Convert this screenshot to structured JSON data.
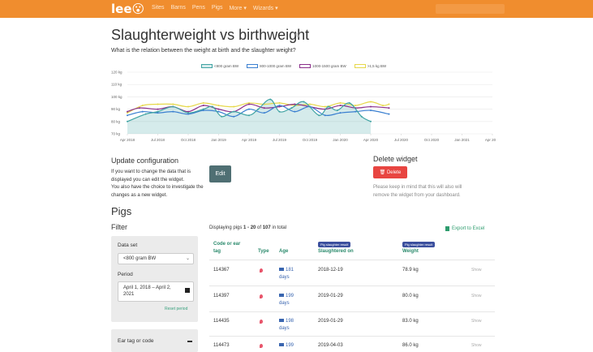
{
  "nav": {
    "logo": "lee😮",
    "items": [
      "Sites",
      "Barns",
      "Pens",
      "Pigs",
      "More ▾",
      "Wizards ▾"
    ]
  },
  "header": {
    "title": "Slaughterweight vs birthweight",
    "subtitle": "What is the relation between the weight at birth and the slaughter weight?"
  },
  "chart_data": {
    "type": "line",
    "title": "",
    "xlabel": "",
    "ylabel": "",
    "y_ticks": [
      "120 kg",
      "110 kg",
      "100 kg",
      "90 kg",
      "80 kg",
      "70 kg"
    ],
    "ylim": [
      70,
      120
    ],
    "x_ticks": [
      "Apr 2018",
      "Jul 2018",
      "Oct 2018",
      "Jan 2019",
      "Apr 2019",
      "Jul 2019",
      "Oct 2019",
      "Jan 2020",
      "Apr 2020",
      "Jul 2020",
      "Oct 2020",
      "Jan 2021",
      "Apr 2021"
    ],
    "series": [
      {
        "name": "<800 gram BW",
        "color": "#3fa3a3",
        "fill": true,
        "points": [
          [
            0,
            80
          ],
          [
            0.6,
            86
          ],
          [
            1.0,
            88
          ],
          [
            1.5,
            92
          ],
          [
            2.0,
            87
          ],
          [
            2.5,
            90
          ],
          [
            2.8,
            92
          ],
          [
            3.1,
            84
          ],
          [
            3.5,
            88
          ],
          [
            4.0,
            85
          ],
          [
            4.3,
            90
          ],
          [
            4.7,
            98
          ],
          [
            5.0,
            88
          ],
          [
            5.4,
            91
          ],
          [
            5.8,
            96
          ],
          [
            6.3,
            85
          ],
          [
            6.6,
            92
          ],
          [
            6.9,
            89
          ],
          [
            7.3,
            95
          ],
          [
            7.7,
            84
          ],
          [
            8.0,
            80
          ]
        ]
      },
      {
        "name": "800-1000 gram BW",
        "color": "#3a7fd0",
        "fill": false,
        "points": [
          [
            0,
            85
          ],
          [
            0.5,
            88
          ],
          [
            1.0,
            87
          ],
          [
            1.5,
            88
          ],
          [
            2.0,
            86
          ],
          [
            2.5,
            89
          ],
          [
            3.0,
            88
          ],
          [
            3.5,
            84
          ],
          [
            4.0,
            90
          ],
          [
            4.5,
            87
          ],
          [
            5.0,
            93
          ],
          [
            5.5,
            88
          ],
          [
            6.0,
            92
          ],
          [
            6.5,
            85
          ],
          [
            7.0,
            87
          ],
          [
            7.5,
            88
          ],
          [
            8.0,
            89
          ],
          [
            8.6,
            86
          ]
        ]
      },
      {
        "name": "1000-1500 gram BW",
        "color": "#8a2e8a",
        "fill": false,
        "points": [
          [
            0,
            88
          ],
          [
            0.4,
            91
          ],
          [
            1.0,
            90
          ],
          [
            1.5,
            92
          ],
          [
            2.0,
            88
          ],
          [
            2.5,
            93
          ],
          [
            3.0,
            90
          ],
          [
            3.5,
            88
          ],
          [
            4.0,
            94
          ],
          [
            4.5,
            91
          ],
          [
            5.0,
            92
          ],
          [
            5.5,
            94
          ],
          [
            6.0,
            92
          ],
          [
            6.5,
            90
          ],
          [
            7.0,
            93
          ],
          [
            7.5,
            91
          ],
          [
            8.0,
            92
          ],
          [
            8.6,
            91
          ]
        ]
      },
      {
        "name": ">1,5 kg BW",
        "color": "#e6d84a",
        "fill": false,
        "points": [
          [
            0,
            87
          ],
          [
            0.5,
            93
          ],
          [
            1.0,
            94
          ],
          [
            1.5,
            94
          ],
          [
            2.0,
            92
          ],
          [
            2.5,
            95
          ],
          [
            3.0,
            93
          ],
          [
            3.5,
            92
          ],
          [
            4.0,
            95
          ],
          [
            4.5,
            94
          ],
          [
            5.0,
            95
          ],
          [
            5.5,
            93
          ],
          [
            6.0,
            94
          ],
          [
            6.5,
            92
          ],
          [
            7.0,
            95
          ],
          [
            7.5,
            93
          ],
          [
            8.0,
            96
          ],
          [
            8.4,
            93
          ],
          [
            8.6,
            94
          ]
        ]
      }
    ]
  },
  "update_config": {
    "heading": "Update configuration",
    "text_lines": [
      "If you want to change the data that is",
      "displayed you can edit the widget.",
      "You also have the choice to investigate the",
      "changes as a new widget."
    ],
    "edit_label": "Edit"
  },
  "delete_widget": {
    "heading": "Delete widget",
    "button_label": "🗑 Delete",
    "text_lines": [
      "Please keep in mind that this will also will",
      "remove the widget from your dashboard."
    ]
  },
  "pigs": {
    "title": "Pigs",
    "filter_title": "Filter",
    "dataset_label": "Data set",
    "dataset_value": "<800 gram BW",
    "period_label": "Period",
    "period_value_line1": "April 1, 2018 – April 2,",
    "period_value_line2": "2021",
    "reset_label": "Reset period",
    "eartag_label": "Ear tag or code",
    "displaying_prefix": "Displaying pigs ",
    "displaying_range": "1 - 20",
    "displaying_mid": " of ",
    "displaying_total": "107",
    "displaying_suffix": " in total",
    "export_label": "Export to Excel",
    "columns": {
      "tag_line1": "Code or ear",
      "tag_line2": "tag",
      "type": "Type",
      "age": "Age",
      "badge": "Pig slaughter result",
      "slaughtered": "Slaughtered on",
      "weight": "Weight"
    },
    "rows": [
      {
        "tag": "114367",
        "age_num": "181",
        "age_unit": "days",
        "date": "2018-12-19",
        "weight": "78.9 kg",
        "show": "Show"
      },
      {
        "tag": "114397",
        "age_num": "199",
        "age_unit": "days",
        "date": "2019-01-29",
        "weight": "80.0 kg",
        "show": "Show"
      },
      {
        "tag": "114435",
        "age_num": "198",
        "age_unit": "days",
        "date": "2019-01-29",
        "weight": "83.0 kg",
        "show": "Show"
      },
      {
        "tag": "114473",
        "age_num": "199",
        "age_unit": "",
        "date": "2019-04-03",
        "weight": "86.0 kg",
        "show": "Show"
      }
    ]
  }
}
